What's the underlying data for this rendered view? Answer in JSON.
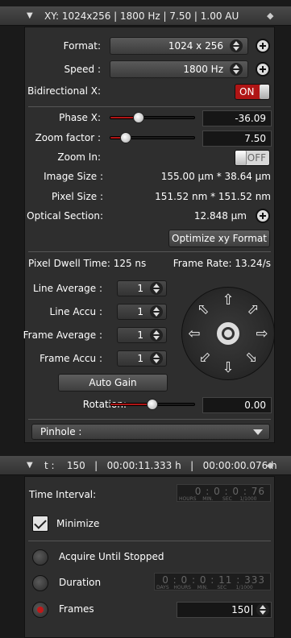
{
  "xy_panel": {
    "header": "XY: 1024x256 | 1800 Hz | 7.50 | 1.00 AU",
    "format_label": "Format:",
    "format_value": "1024 x 256",
    "speed_label": "Speed :",
    "speed_value": "1800 Hz",
    "bidirectional_label": "Bidirectional X:",
    "bidirectional_state": "ON",
    "phase_label": "Phase  X:",
    "phase_value": "-36.09",
    "zoom_factor_label": "Zoom factor :",
    "zoom_factor_value": "7.50",
    "zoom_in_label": "Zoom In:",
    "zoom_in_state": "OFF",
    "image_size_label": "Image Size :",
    "image_size_value": "155.00 µm * 38.64 µm",
    "pixel_size_label": "Pixel Size :",
    "pixel_size_value": "151.52 nm * 151.52 nm",
    "optical_section_label": "Optical Section:",
    "optical_section_value": "12.848 µm",
    "optimize_button": "Optimize xy Format",
    "pixel_dwell_time": "Pixel Dwell Time: 125 ns",
    "frame_rate": "Frame Rate: 13.24/s",
    "line_average_label": "Line Average :",
    "line_average_value": "1",
    "line_accu_label": "Line Accu :",
    "line_accu_value": "1",
    "frame_average_label": "Frame Average :",
    "frame_average_value": "1",
    "frame_accu_label": "Frame Accu :",
    "frame_accu_value": "1",
    "auto_gain_button": "Auto Gain",
    "rotation_label": "Rotation:",
    "rotation_value": "0.00",
    "pinhole_label": "Pinhole :"
  },
  "t_panel": {
    "header": "t :    150   |   00:00:11.333 h   |   00:00:00.076 h",
    "time_interval_label": "Time Interval:",
    "time_interval_value": "0 : 0 : 0 : 76",
    "time_interval_units": "HOURS    MIN.      SEC     1/1000",
    "minimize_label": "Minimize",
    "acquire_until_stopped_label": "Acquire Until Stopped",
    "duration_label": "Duration",
    "duration_value": "0 : 0 : 0 : 11 : 333",
    "duration_units": "DAYS   HOURS    MIN.      SEC      1/1000",
    "frames_label": "Frames",
    "frames_value": "150"
  },
  "colors": {
    "accent_red": "#b01515",
    "panel_bg": "#2e2e2e"
  }
}
